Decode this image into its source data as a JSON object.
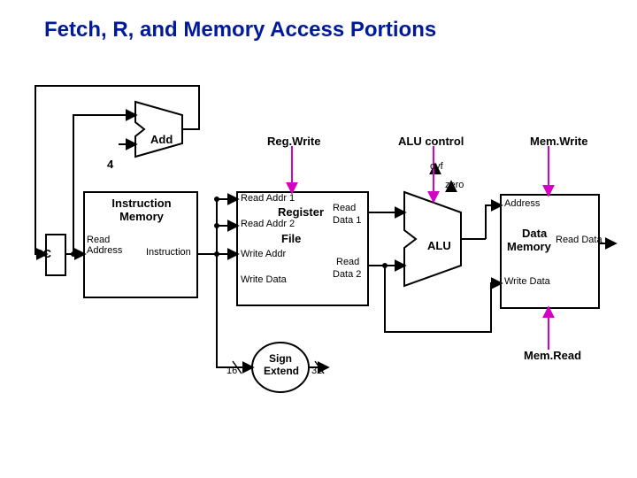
{
  "title": "Fetch, R, and Memory Access Portions",
  "labels": {
    "pc": "PC",
    "add": "Add",
    "four": "4",
    "instr_mem_line1": "Instruction",
    "instr_mem_line2": "Memory",
    "read_address": "Read\nAddress",
    "instruction_out": "Instruction",
    "reg_write": "Reg.Write",
    "read_addr1": "Read Addr 1",
    "read_addr2": "Read Addr 2",
    "write_addr": "Write Addr",
    "write_data_rf": "Write Data",
    "register": "Register",
    "file": "File",
    "read": "Read",
    "data1": "Data 1",
    "read_data2_l1": "Read",
    "read_data2_l2": "Data 2",
    "alu_control": "ALU control",
    "ovf": "ovf",
    "zero": "zero",
    "alu": "ALU",
    "mem_write": "Mem.Write",
    "address_dm": "Address",
    "data_l1": "Data",
    "data_l2": "Memory",
    "read_data_dm": "Read Data",
    "write_data_dm": "Write Data",
    "mem_read": "Mem.Read",
    "sign": "Sign",
    "extend": "Extend",
    "sixteen": "16",
    "thirtytwo": "32"
  }
}
